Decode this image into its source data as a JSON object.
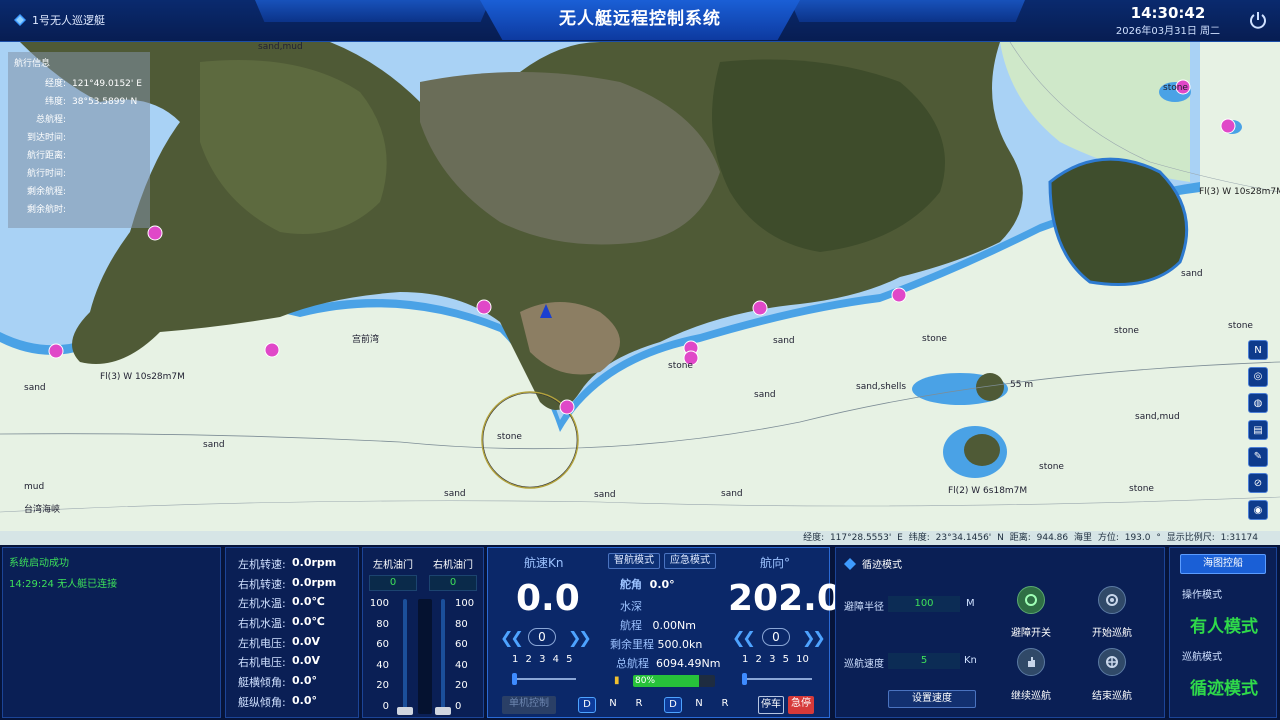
{
  "header": {
    "boat_name": "1号无人巡逻艇",
    "title": "无人艇远程控制系统",
    "time": "14:30:42",
    "date": "2026年03月31日 周二"
  },
  "nav_info": {
    "title": "航行信息",
    "rows": [
      {
        "label": "经度:",
        "value": "121°49.0152' E"
      },
      {
        "label": "纬度:",
        "value": "38°53.5899' N"
      },
      {
        "label": "总航程:",
        "value": ""
      },
      {
        "label": "到达时间:",
        "value": ""
      },
      {
        "label": "航行距离:",
        "value": ""
      },
      {
        "label": "航行时间:",
        "value": ""
      },
      {
        "label": "剩余航程:",
        "value": ""
      },
      {
        "label": "剩余航时:",
        "value": ""
      }
    ]
  },
  "map": {
    "status": "经度: 117°28.5553' E   纬度: 23°34.1456' N   距离: 944.86 海里   方位: 193.0 °  显示比例尺: 1:31174",
    "labels": {
      "sand1": "sand,mud",
      "sand2": "sand",
      "sand3": "sand",
      "gongqian": "宫前湾",
      "stone1": "stone",
      "taiwan": "台湾海峡",
      "mud": "mud",
      "stone2": "stone",
      "sandshells": "sand,shells",
      "stone3": "stone",
      "stone4": "stone",
      "sandmud2": "sand,mud",
      "stone5": "stone",
      "stone6": "stone",
      "stone7": "stone",
      "light1": "Fl(3) W 10s28m7M",
      "light2": "Fl(3) W 10s28m7M",
      "light3": "Fl(2) W 6s18m7M",
      "depth55": "55 m",
      "sand4": "sand",
      "sand5": "sand",
      "sand6": "sand",
      "sand7": "sand",
      "sand8": "sand",
      "sand9": "sand",
      "stone8": "stone"
    },
    "tools": [
      "N",
      "◎",
      "◍",
      "▤",
      "✎",
      "⊘",
      "◉"
    ]
  },
  "log": {
    "line1": "系统启动成功",
    "line2": "14:29:24 无人艇已连接"
  },
  "engine": [
    {
      "label": "左机转速:",
      "value": "0.0rpm"
    },
    {
      "label": "右机转速:",
      "value": "0.0rpm"
    },
    {
      "label": "左机水温:",
      "value": "0.0℃"
    },
    {
      "label": "右机水温:",
      "value": "0.0℃"
    },
    {
      "label": "左机电压:",
      "value": "0.0V"
    },
    {
      "label": "右机电压:",
      "value": "0.0V"
    },
    {
      "label": "艇横倾角:",
      "value": "0.0°"
    },
    {
      "label": "艇纵倾角:",
      "value": "0.0°"
    }
  ],
  "throttle": {
    "left_label": "左机油门",
    "right_label": "右机油门",
    "left_value": "0",
    "right_value": "0",
    "scale": [
      "100",
      "80",
      "60",
      "40",
      "20",
      "0"
    ]
  },
  "main": {
    "speed_label": "航速Kn",
    "speed_value": "0.0",
    "speed_set": "0",
    "speed_ticks": "1 2 3 4 5",
    "heading_label": "航向°",
    "heading_value": "202.0",
    "heading_set": "0",
    "heading_ticks": "1 2 3 5 10",
    "mode_smart": "智航模式",
    "mode_emergency": "应急模式",
    "rudder_label": "舵角",
    "rudder_value": "0.0°",
    "depth_label": "水深",
    "distance_label": "航程",
    "distance_value": "0.00Nm",
    "remaining_label": "剩余里程",
    "remaining_value": "500.0kn",
    "total_label": "总航程",
    "total_value": "6094.49Nm",
    "battery_text": "80%",
    "battery_level": 0.8,
    "single_control": "单机控制",
    "gears_left": [
      "D",
      "N",
      "R"
    ],
    "gears_right": [
      "D",
      "N",
      "R"
    ],
    "stop": "停车",
    "emergency_stop": "急停"
  },
  "track": {
    "title": "循迹模式",
    "radius_label": "避障半径",
    "radius_value": "100",
    "radius_unit": "M",
    "speed_label": "巡航速度",
    "speed_value": "5",
    "speed_unit": "Kn",
    "set_speed": "设置速度",
    "btn_avoid": "避障开关",
    "btn_start": "开始巡航",
    "btn_continue": "继续巡航",
    "btn_end": "结束巡航"
  },
  "mode": {
    "top_button": "海图控船",
    "op_label": "操作模式",
    "op_value": "有人模式",
    "cruise_label": "巡航模式",
    "cruise_value": "循迹模式"
  },
  "colors": {
    "accent": "#1a5fd6",
    "ok_green": "#2fd94a",
    "danger": "#d63a3a"
  }
}
